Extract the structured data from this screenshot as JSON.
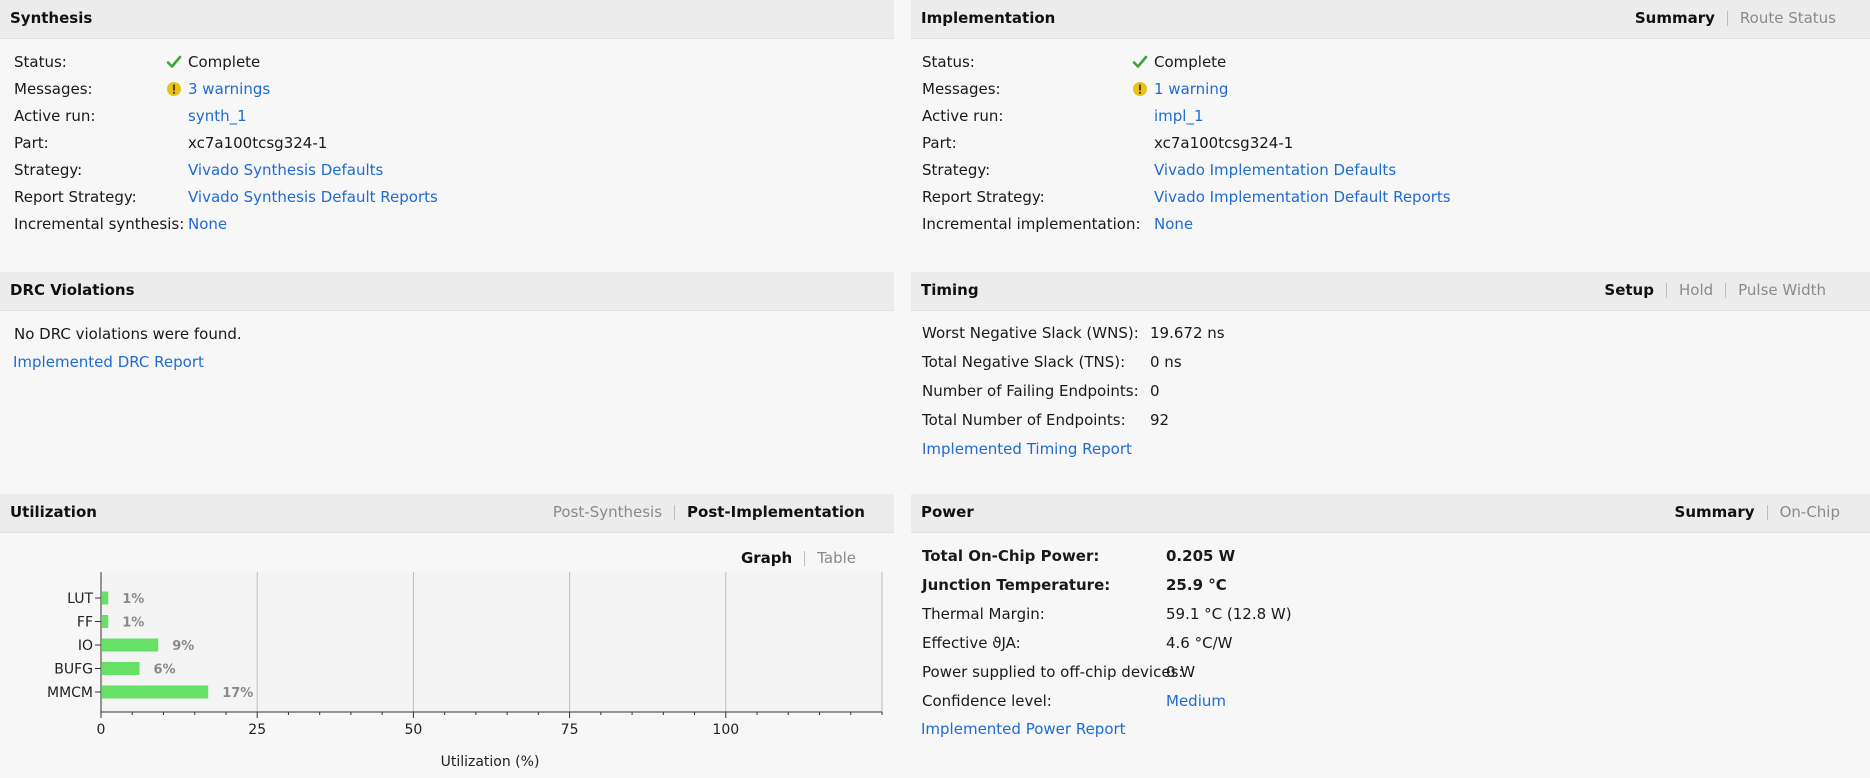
{
  "synthesis": {
    "title": "Synthesis",
    "rows": [
      {
        "label": "Status:",
        "value": "Complete"
      },
      {
        "label": "Messages:",
        "value": "3 warnings"
      },
      {
        "label": "Active run:",
        "value": "synth_1"
      },
      {
        "label": "Part:",
        "value": "xc7a100tcsg324-1"
      },
      {
        "label": "Strategy:",
        "value": "Vivado Synthesis Defaults"
      },
      {
        "label": "Report Strategy:",
        "value": "Vivado Synthesis Default Reports"
      },
      {
        "label": "Incremental synthesis:",
        "value": "None"
      }
    ]
  },
  "implementation": {
    "title": "Implementation",
    "tabs": [
      "Summary",
      "Route Status"
    ],
    "rows": [
      {
        "label": "Status:",
        "value": "Complete"
      },
      {
        "label": "Messages:",
        "value": "1 warning"
      },
      {
        "label": "Active run:",
        "value": "impl_1"
      },
      {
        "label": "Part:",
        "value": "xc7a100tcsg324-1"
      },
      {
        "label": "Strategy:",
        "value": "Vivado Implementation Defaults"
      },
      {
        "label": "Report Strategy:",
        "value": "Vivado Implementation Default Reports"
      },
      {
        "label": "Incremental implementation:",
        "value": "None"
      }
    ]
  },
  "drc": {
    "title": "DRC Violations",
    "message": "No DRC violations were found.",
    "report_link": "Implemented DRC Report"
  },
  "timing": {
    "title": "Timing",
    "tabs": [
      "Setup",
      "Hold",
      "Pulse Width"
    ],
    "rows": [
      {
        "label": "Worst Negative Slack (WNS):",
        "value": "19.672 ns"
      },
      {
        "label": "Total Negative Slack (TNS):",
        "value": "0 ns"
      },
      {
        "label": "Number of Failing Endpoints:",
        "value": "0"
      },
      {
        "label": "Total Number of Endpoints:",
        "value": "92"
      }
    ],
    "report_link": "Implemented Timing Report"
  },
  "utilization": {
    "title": "Utilization",
    "tabs": [
      "Post-Synthesis",
      "Post-Implementation"
    ],
    "view_tabs": [
      "Graph",
      "Table"
    ]
  },
  "power": {
    "title": "Power",
    "tabs": [
      "Summary",
      "On-Chip"
    ],
    "rows": [
      {
        "label": "Total On-Chip Power:",
        "value": "0.205 W"
      },
      {
        "label": "Junction Temperature:",
        "value": "25.9 °C"
      },
      {
        "label": "Thermal Margin:",
        "value": "59.1 °C (12.8 W)"
      },
      {
        "label": "Effective ϑJA:",
        "value": "4.6 °C/W"
      },
      {
        "label": "Power supplied to off-chip devices:",
        "value": "0 W"
      },
      {
        "label": "Confidence level:",
        "value": "Medium"
      }
    ],
    "report_link": "Implemented Power Report"
  },
  "colors": {
    "link": "#1f6bd1",
    "check": "#3aa53a",
    "warning": "#e8c21a",
    "bar": "#66e066"
  },
  "icons": {
    "status": "check-icon",
    "messages": "warning-icon"
  },
  "chart_data": {
    "type": "bar",
    "orientation": "horizontal",
    "categories": [
      "LUT",
      "FF",
      "IO",
      "BUFG",
      "MMCM"
    ],
    "values": [
      1,
      1,
      9,
      6,
      17
    ],
    "value_labels": [
      "1%",
      "1%",
      "9%",
      "6%",
      "17%"
    ],
    "xlabel": "Utilization (%)",
    "ylabel": "",
    "xlim": [
      0,
      125
    ],
    "xticks": [
      0,
      25,
      50,
      75,
      100
    ],
    "grid": true
  }
}
